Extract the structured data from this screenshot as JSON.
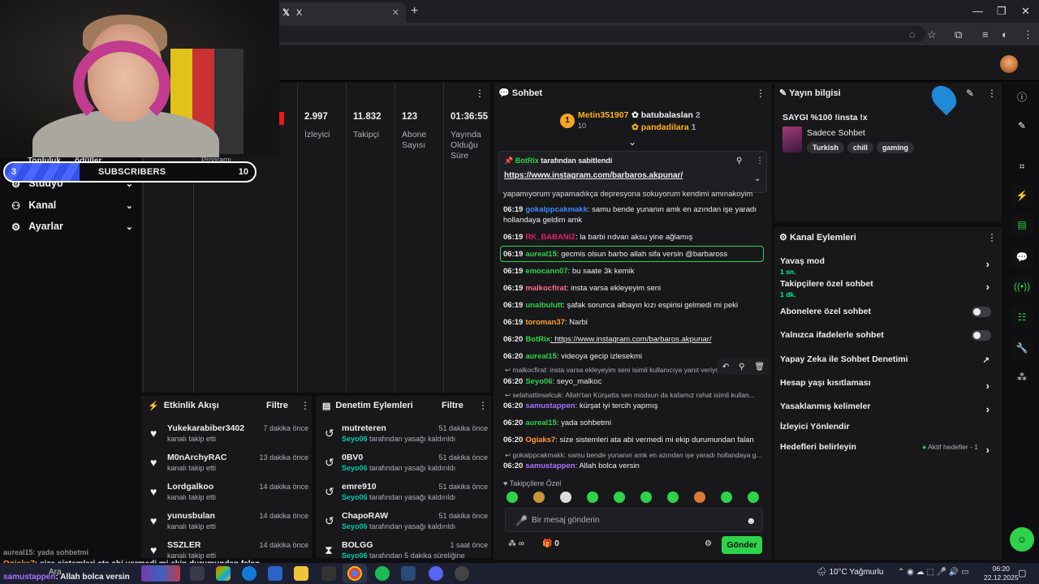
{
  "browser": {
    "tab_title": "X",
    "tab_glyph": "𝕏"
  },
  "nav": {
    "items": [
      {
        "label": "Stüdyo"
      },
      {
        "label": "Kanal"
      },
      {
        "label": "Ayarlar"
      }
    ],
    "overlap_left": "Topluluk",
    "overlap_right": "ödüller",
    "program_label": "Programı"
  },
  "sub_goal": {
    "current": "3",
    "label": "SUBSCRIBERS",
    "goal": "10",
    "progress": 0.3
  },
  "stats": [
    {
      "value": "2.997",
      "label": "İzleyici"
    },
    {
      "value": "11.832",
      "label": "Takipçi"
    },
    {
      "value": "123",
      "label": "Abone Sayısı"
    },
    {
      "value": "01:36:55",
      "label": "Yayında Olduğu Süre"
    }
  ],
  "activity": {
    "title": "Etkinlik Akışı",
    "filter": "Filtre",
    "items": [
      {
        "name": "Yukekarabiber3402",
        "action": "kanalı takip etti",
        "time": "7 dakika önce"
      },
      {
        "name": "M0nArchyRAC",
        "action": "kanalı takip etti",
        "time": "13 dakika önce"
      },
      {
        "name": "Lordgalkoo",
        "action": "kanalı takip etti",
        "time": "14 dakika önce"
      },
      {
        "name": "yunusbulan",
        "action": "kanalı takip etti",
        "time": "14 dakika önce"
      },
      {
        "name": "SSZLER",
        "action": "kanalı takip etti",
        "time": "14 dakika önce"
      }
    ]
  },
  "moderation": {
    "title": "Denetim Eylemleri",
    "filter": "Filtre",
    "items": [
      {
        "name": "mutreteren",
        "by": "Seyo06",
        "action": "tarafından yasağı kaldırıldı",
        "time": "51 dakika önce",
        "icon": "unban-icon"
      },
      {
        "name": "0BV0",
        "by": "Seyo06",
        "action": "tarafından yasağı kaldırıldı",
        "time": "51 dakika önce",
        "icon": "unban-icon"
      },
      {
        "name": "emre910",
        "by": "Seyo06",
        "action": "tarafından yasağı kaldırıldı",
        "time": "51 dakika önce",
        "icon": "unban-icon"
      },
      {
        "name": "ChapoRAW",
        "by": "Seyo06",
        "action": "tarafından yasağı kaldırıldı",
        "time": "51 dakika önce",
        "icon": "unban-icon"
      },
      {
        "name": "BOLGG",
        "by": "Seyo06",
        "action": "tarafından 5 dakika süreliğine",
        "time": "1 saat önce",
        "icon": "timeout-icon"
      }
    ]
  },
  "chat": {
    "title": "Sohbet",
    "leaderboard": {
      "top": {
        "name": "Metin351907",
        "rank": "1",
        "count": "10"
      },
      "others": [
        {
          "name": "batubalaslan",
          "count": "2"
        },
        {
          "name": "pandadilara",
          "count": "1"
        }
      ]
    },
    "pinned": {
      "by": "BotRix",
      "suffix": "tarafından sabitlendi",
      "link": "https://www.instagram.com/barbaros.akpunar/"
    },
    "cut_line": "yapamıyorum yapamadıkça depresyona sokuyorum kendimi amınakoyim",
    "messages": [
      {
        "ts": "06:19",
        "user": "gokalppcakmakk",
        "color": "#3d8bff",
        "text": ": samu bende yunanın amk en azından işe yaradı hollandaya geldim amk"
      },
      {
        "ts": "06:19",
        "user": "RK_BABANIZ",
        "color": "#e0206a",
        "text": ": la barbi rıdvan aksu yine ağlamış"
      },
      {
        "ts": "06:19",
        "user": "aureal15",
        "color": "#2fd34a",
        "text": ": gecmis olsun barbo allah sifa versin @barbaross"
      },
      {
        "ts": "06:19",
        "user": "emocann07",
        "color": "#2fd34a",
        "text": ": bu saate 3k kemik"
      },
      {
        "ts": "06:19",
        "user": "malkocfirat",
        "color": "#ff6a8a",
        "text": ": insta varsa ekleyeyim seni"
      },
      {
        "ts": "06:19",
        "user": "unalbulutt",
        "color": "#2fd34a",
        "text": ": şafak sorunca albayın kızı espirisi gelmedi mi peki"
      },
      {
        "ts": "06:19",
        "user": "toroman37",
        "color": "#ff9e2c",
        "text": ": Narbi"
      },
      {
        "ts": "06:20",
        "user": "BotRix",
        "color": "#2fd34a",
        "text": ": https://www.instagram.com/barbaros.akpunar/"
      },
      {
        "ts": "06:20",
        "user": "aureal15",
        "color": "#2fd34a",
        "text": ": videoya gecip izlesekmi"
      },
      {
        "ts": "06:20",
        "user": "Seyo06",
        "color": "#2fd34a",
        "text": ": seyo_malkoc"
      },
      {
        "ts": "06:20",
        "user": "samustappen",
        "color": "#a970ff",
        "text": ": kürşat iyi tercih yapmış"
      },
      {
        "ts": "06:20",
        "user": "aureal15",
        "color": "#2fd34a",
        "text": ": yada sohbetmi"
      },
      {
        "ts": "06:20",
        "user": "Ogiaks7",
        "color": "#ff9e2c",
        "text": ": size sistemleri ata abi vermedi mi ekip durumundan falan"
      },
      {
        "ts": "06:20",
        "user": "samustappen",
        "color": "#a970ff",
        "text": ": Allah bolca versin"
      }
    ],
    "replies": [
      "malkocfirat: insta varsa ekleyeyim seni isimli kullanıcıya yanıt veriyor",
      "selahattinselcuk: Allah'tan Kürşatta sen modsun da kafamız rahat isimli kullan...",
      "gokalppcakmakk: samu bende yunanın amk en azından işe yaradı hollandaya g..."
    ],
    "follower_only": "Takipçilere Özel",
    "input_placeholder": "Bir mesaj gönderin",
    "points": "0",
    "send": "Gönder"
  },
  "stream_info": {
    "title": "Yayın bilgisi",
    "stream_title": "SAYGI %100 !insta !x",
    "category": "Sadece Sohbet",
    "tags": [
      "Turkish",
      "chill",
      "gaming"
    ]
  },
  "channel_actions": {
    "title": "Kanal Eylemleri",
    "rows": [
      {
        "label": "Yavaş mod",
        "sub": "1 sn.",
        "kind": "arrow"
      },
      {
        "label": "Takipçilere özel sohbet",
        "sub": "1 dk.",
        "kind": "arrow"
      },
      {
        "label": "Abonelere özel sohbet",
        "sub": "",
        "kind": "toggle"
      },
      {
        "label": "Yalnızca ifadelerle sohbet",
        "sub": "",
        "kind": "toggle"
      },
      {
        "label": "Yapay Zeka ile Sohbet Denetimi",
        "sub": "",
        "kind": "external"
      },
      {
        "label": "Hesap yaşı kısıtlaması",
        "sub": "",
        "kind": "arrow"
      },
      {
        "label": "Yasaklanmış kelimeler",
        "sub": "",
        "kind": "arrow"
      },
      {
        "label": "İzleyici Yönlendir",
        "sub": "",
        "kind": "none"
      },
      {
        "label": "Hedefleri belirleyin",
        "sub": "",
        "kind": "arrow",
        "extra": "Aktif hedefler - 1"
      }
    ]
  },
  "overlay_chat": [
    {
      "user": "aureal15",
      "text": ": yada sohbetmi"
    },
    {
      "user": "Ogiaks7",
      "text": ": size sistemleri ata abi vermedi mi ekip durumundan falan"
    },
    {
      "user": "samustappen",
      "text": ": Allah bolca versin"
    }
  ],
  "taskbar": {
    "weather": "10°C  Yağmurlu",
    "time": "06:20",
    "date": "22.12.2025",
    "search": "Ara"
  },
  "colors": {
    "accent": "#2fd34a",
    "bg": "#0e0e10",
    "panel": "#18181b",
    "sub_blue": "#3d5af1"
  }
}
